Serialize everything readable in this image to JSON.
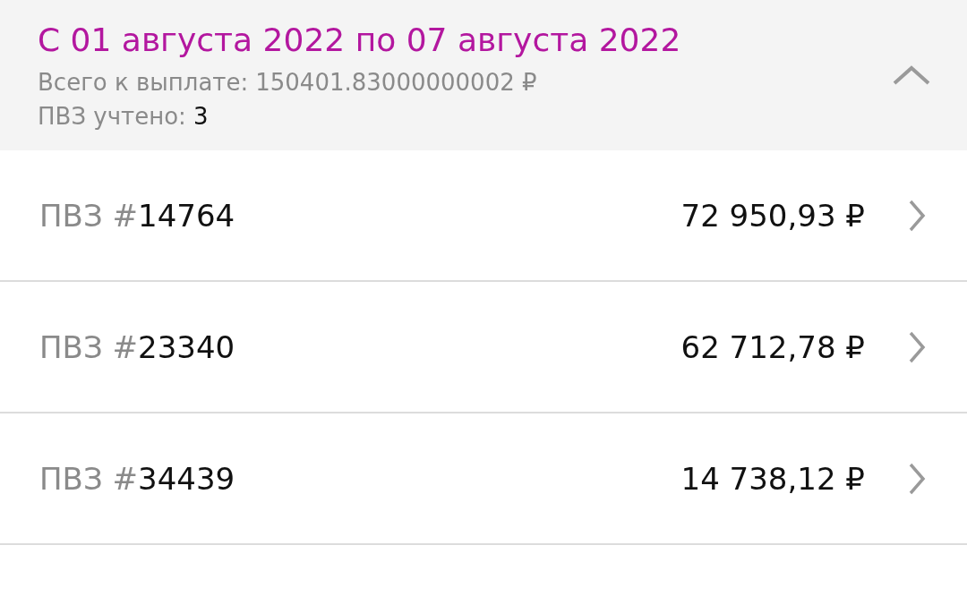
{
  "period": {
    "title": "С 01 августа 2022 по 07 августа 2022",
    "total_label": "Всего к выплате:",
    "total_value": "150401.83000000002 ₽",
    "count_label": "ПВЗ учтено:",
    "count_value": "3",
    "expanded": true
  },
  "points": [
    {
      "prefix": "ПВЗ #",
      "id": "14764",
      "amount": "72 950,93 ₽"
    },
    {
      "prefix": "ПВЗ #",
      "id": "23340",
      "amount": "62 712,78 ₽"
    },
    {
      "prefix": "ПВЗ #",
      "id": "34439",
      "amount": "14 738,12 ₽"
    }
  ]
}
